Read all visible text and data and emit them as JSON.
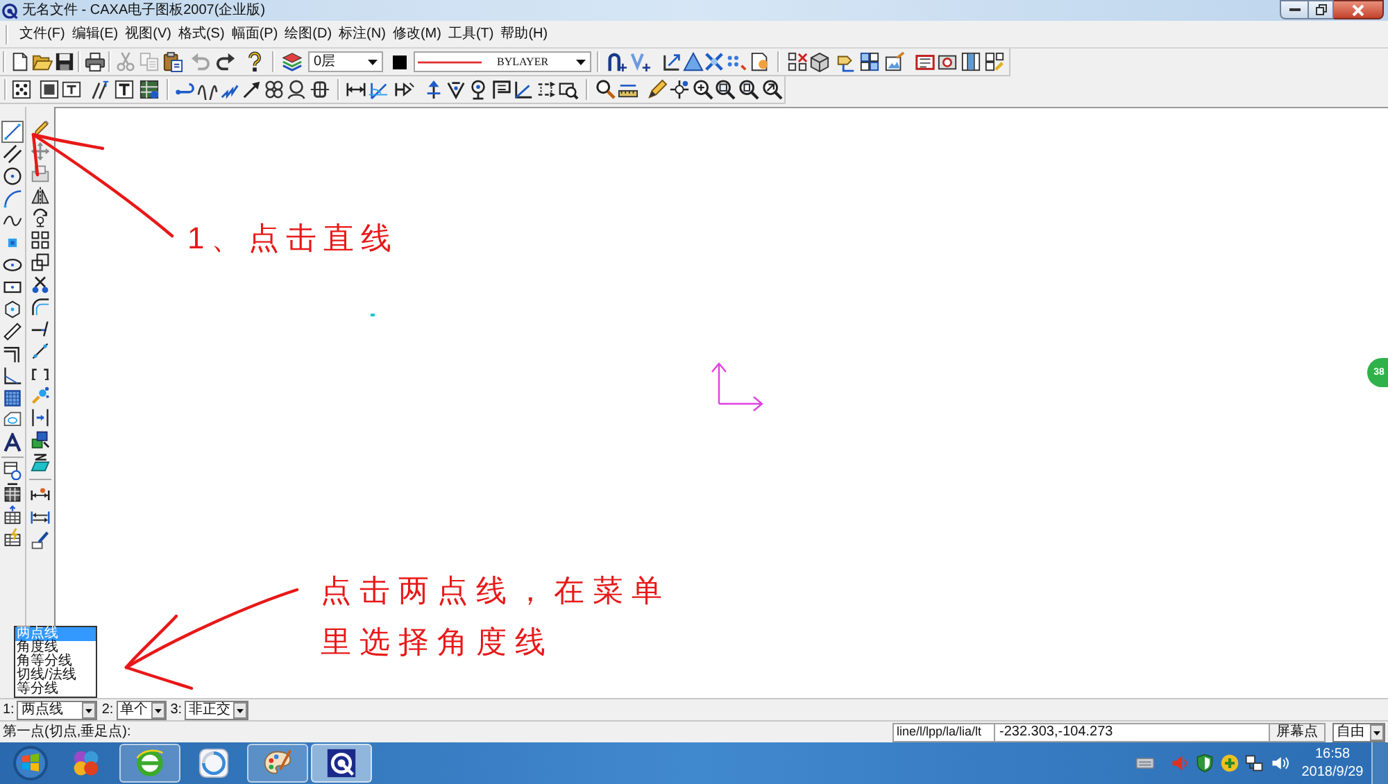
{
  "window": {
    "title": "无名文件 - CAXA电子图板2007(企业版)"
  },
  "menu_bar": [
    "文件(F)",
    "编辑(E)",
    "视图(V)",
    "格式(S)",
    "幅面(P)",
    "绘图(D)",
    "标注(N)",
    "修改(M)",
    "工具(T)",
    "帮助(H)"
  ],
  "standard_toolbar": [
    {
      "disabled": false
    },
    {
      "disabled": false
    },
    {
      "disabled": false
    },
    {
      "disabled": false
    },
    {
      "disabled": true
    },
    {
      "disabled": true
    },
    {
      "disabled": false
    },
    {
      "disabled": true
    },
    {
      "disabled": false
    },
    {
      "disabled": false
    }
  ],
  "properties_toolbar": {
    "layer": "0层",
    "linetype": "BYLAYER"
  },
  "toolbox": [
    {
      "selected": true
    },
    {
      "selected": false
    },
    {
      "selected": false
    },
    {
      "selected": false
    },
    {
      "selected": false
    },
    {
      "selected": false
    },
    {
      "selected": false
    },
    {
      "selected": false
    },
    {
      "selected": false
    },
    {
      "selected": false
    },
    {
      "selected": false
    },
    {
      "selected": false
    },
    {
      "selected": false
    },
    {
      "selected": false
    },
    {
      "selected": false
    },
    {
      "selected": false
    },
    {
      "selected": false
    },
    {
      "selected": false
    },
    {
      "selected": false
    },
    {
      "selected": false
    },
    {
      "selected": false
    },
    {
      "selected": false
    },
    {
      "selected": false
    },
    {
      "selected": false
    },
    {
      "selected": false
    },
    {
      "selected": false
    },
    {
      "selected": false
    },
    {
      "selected": false
    },
    {
      "selected": false
    },
    {
      "selected": false
    },
    {
      "selected": false
    },
    {
      "selected": false
    },
    {
      "selected": false
    },
    {
      "selected": false
    },
    {
      "selected": false
    },
    {
      "selected": false
    },
    {
      "selected": false
    },
    {
      "selected": false
    }
  ],
  "annotations": [
    {
      "lines": [
        "1、点击直线"
      ]
    },
    {
      "lines": [
        "点击两点线，在菜单",
        "里选择角度线"
      ]
    }
  ],
  "floating_widget": {
    "text": "38"
  },
  "line_type_menu": [
    {
      "label": "两点线",
      "selected": true
    },
    {
      "label": "角度线",
      "selected": false
    },
    {
      "label": "角等分线",
      "selected": false
    },
    {
      "label": "切线/法线",
      "selected": false
    },
    {
      "label": "等分线",
      "selected": false
    }
  ],
  "option_bar": [
    {
      "label": "1:",
      "value": "两点线"
    },
    {
      "label": "2:",
      "value": "单个"
    },
    {
      "label": "3:",
      "value": "非正交"
    }
  ],
  "status_bar": {
    "prompt": "第一点(切点,垂足点):",
    "command": "line/l/lpp/la/lia/lt",
    "coordinates": "-232.303,-104.273",
    "point_mode": "屏幕点",
    "snap_mode": "自由"
  },
  "taskbar": {
    "apps": [
      {
        "open": false,
        "active": false
      },
      {
        "open": true,
        "active": false
      },
      {
        "open": false,
        "active": false
      },
      {
        "open": true,
        "active": false
      },
      {
        "open": true,
        "active": true
      }
    ],
    "time": "16:58",
    "date": "2018/9/29"
  }
}
